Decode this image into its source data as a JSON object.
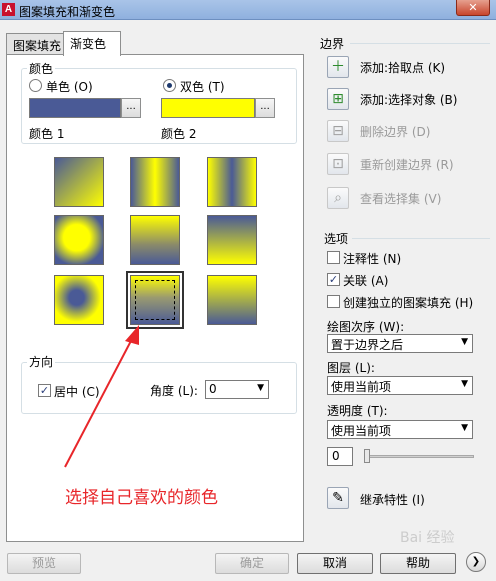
{
  "window": {
    "title": "图案填充和渐变色",
    "close_glyph": "✕",
    "app_icon_letter": "A"
  },
  "tabs": [
    {
      "label": "图案填充",
      "active": false
    },
    {
      "label": "渐变色",
      "active": true
    }
  ],
  "color_group": {
    "title": "颜色",
    "single_label": "单色",
    "single_key": "(O)",
    "double_label": "双色",
    "double_key": "(T)",
    "selected_mode": "double",
    "color1_label": "颜色 1",
    "color2_label": "颜色 2",
    "color1_hex": "#4a5a96",
    "color2_hex": "#ffff00",
    "dots_label": "..."
  },
  "gradient_patterns": [
    {
      "name": "linear-top-bottom",
      "selected": false
    },
    {
      "name": "linear-center-vertical",
      "selected": false
    },
    {
      "name": "linear-center-vertical-inverse",
      "selected": false
    },
    {
      "name": "spherical",
      "selected": false
    },
    {
      "name": "hemispherical",
      "selected": false
    },
    {
      "name": "curved",
      "selected": false
    },
    {
      "name": "inverse-spherical",
      "selected": false
    },
    {
      "name": "inverse-hemispherical",
      "selected": true
    },
    {
      "name": "inverse-curved",
      "selected": false
    }
  ],
  "direction_group": {
    "title": "方向",
    "centered_label": "居中",
    "centered_key": "(C)",
    "centered_checked": true,
    "angle_label": "角度",
    "angle_key": "(L):",
    "angle_value": "0"
  },
  "boundary": {
    "title": "边界",
    "actions": [
      {
        "label": "添加:拾取点",
        "key": "(K)",
        "icon": "add-pick-icon",
        "enabled": true
      },
      {
        "label": "添加:选择对象",
        "key": "(B)",
        "icon": "add-select-icon",
        "enabled": true
      },
      {
        "label": "删除边界",
        "key": "(D)",
        "icon": "remove-boundary-icon",
        "enabled": false
      },
      {
        "label": "重新创建边界",
        "key": "(R)",
        "icon": "recreate-boundary-icon",
        "enabled": false
      },
      {
        "label": "查看选择集",
        "key": "(V)",
        "icon": "view-selection-icon",
        "enabled": false
      }
    ]
  },
  "options": {
    "title": "选项",
    "annotative_label": "注释性",
    "annotative_key": "(N)",
    "annotative_checked": false,
    "associative_label": "关联",
    "associative_key": "(A)",
    "associative_checked": true,
    "separate_label": "创建独立的图案填充",
    "separate_key": "(H)",
    "separate_checked": false,
    "draw_order_label": "绘图次序",
    "draw_order_key": "(W):",
    "draw_order_value": "置于边界之后",
    "layer_label": "图层",
    "layer_key": "(L):",
    "layer_value": "使用当前项",
    "transparency_label": "透明度",
    "transparency_key": "(T):",
    "transparency_value": "使用当前项",
    "transparency_amount": "0",
    "transparency_level": 0
  },
  "inherit": {
    "label": "继承特性",
    "key": "(I)"
  },
  "footer": {
    "preview_label": "预览",
    "ok_label": "确定",
    "cancel_label": "取消",
    "help_label": "帮助",
    "more_glyph": "❯"
  },
  "annotation_text": "选择自己喜欢的颜色",
  "watermark_text": "Bai 经验",
  "dropdown_arrow": "▼"
}
